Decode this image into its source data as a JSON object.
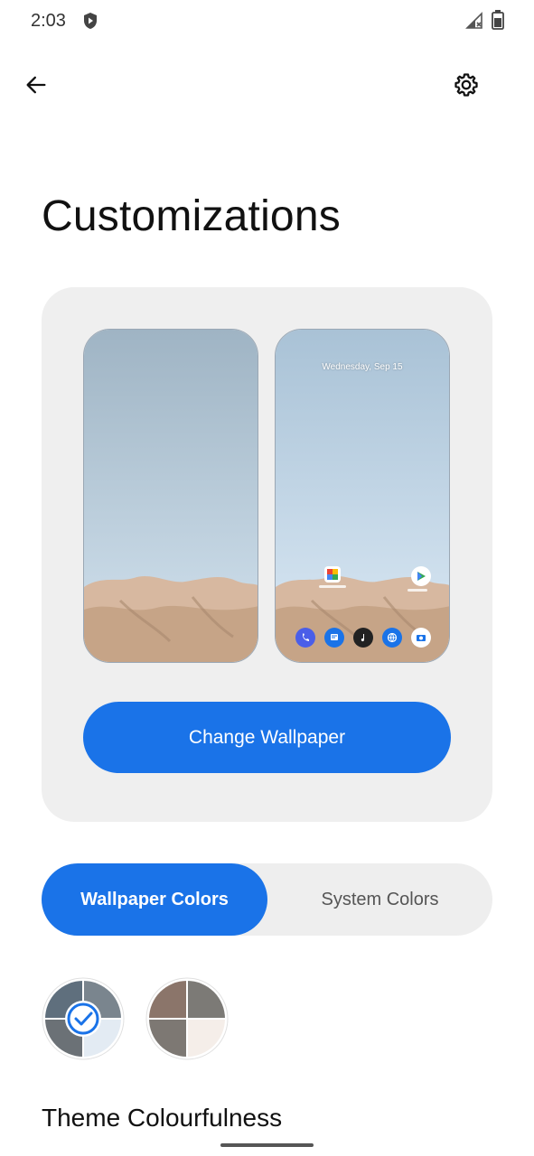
{
  "status_bar": {
    "time": "2:03"
  },
  "toolbar": {
    "back_icon": "arrow-back-icon",
    "settings_icon": "gear-icon"
  },
  "page": {
    "title": "Customizations"
  },
  "preview": {
    "home_screen_date": "Wednesday, Sep 15",
    "change_wallpaper_label": "Change Wallpaper"
  },
  "color_source_tabs": [
    {
      "label": "Wallpaper Colors",
      "selected": true
    },
    {
      "label": "System Colors",
      "selected": false
    }
  ],
  "swatches": [
    {
      "colors": [
        "#5f6f7d",
        "#7a858e",
        "#e3ebf3",
        "#6b7176"
      ],
      "selected": true
    },
    {
      "colors": [
        "#8b756a",
        "#7c7a76",
        "#f5eee9",
        "#7d7873"
      ],
      "selected": false
    }
  ],
  "section": {
    "theme_colourfulness_label": "Theme Colourfulness"
  },
  "colors": {
    "accent": "#1a73e8",
    "card_bg": "#efefef"
  }
}
